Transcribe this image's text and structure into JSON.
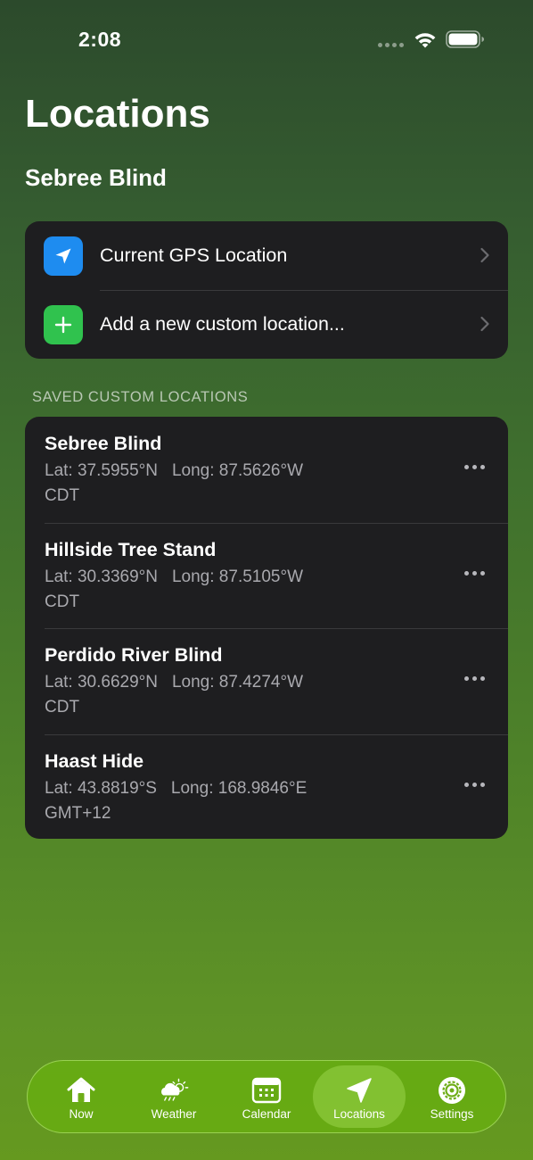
{
  "status_bar": {
    "time": "2:08"
  },
  "header": {
    "title": "Locations",
    "current_location": "Sebree Blind"
  },
  "actions": [
    {
      "label": "Current GPS Location",
      "icon": "location-arrow-icon",
      "color": "#1e8cf0"
    },
    {
      "label": "Add a new custom location...",
      "icon": "plus-icon",
      "color": "#30c24e"
    }
  ],
  "saved_section": {
    "header": "SAVED CUSTOM LOCATIONS",
    "items": [
      {
        "name": "Sebree Blind",
        "lat": "Lat: 37.5955°N",
        "long": "Long: 87.5626°W",
        "tz": "CDT"
      },
      {
        "name": "Hillside Tree Stand",
        "lat": "Lat: 30.3369°N",
        "long": "Long: 87.5105°W",
        "tz": "CDT"
      },
      {
        "name": "Perdido River Blind",
        "lat": "Lat: 30.6629°N",
        "long": "Long: 87.4274°W",
        "tz": "CDT"
      },
      {
        "name": "Haast Hide",
        "lat": "Lat: 43.8819°S",
        "long": "Long: 168.9846°E",
        "tz": "GMT+12"
      }
    ]
  },
  "tab_bar": {
    "tabs": [
      {
        "label": "Now",
        "icon": "house-icon",
        "active": false
      },
      {
        "label": "Weather",
        "icon": "cloud-sun-rain-icon",
        "active": false
      },
      {
        "label": "Calendar",
        "icon": "calendar-icon",
        "active": false
      },
      {
        "label": "Locations",
        "icon": "location-arrow-icon",
        "active": true
      },
      {
        "label": "Settings",
        "icon": "gear-icon",
        "active": false
      }
    ]
  },
  "colors": {
    "card_background": "#1e1e20",
    "secondary_text": "#a9a9ae",
    "tab_bar": "#68b010"
  }
}
